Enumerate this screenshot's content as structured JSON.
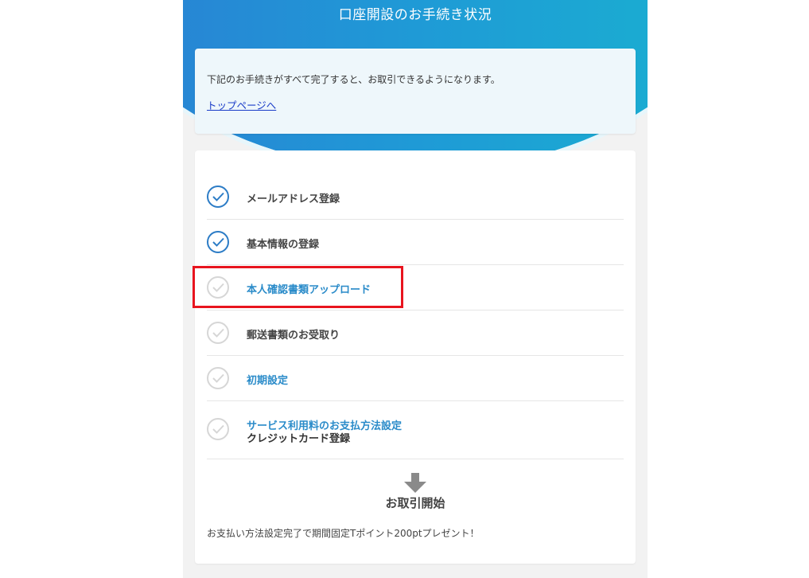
{
  "header": {
    "title": "口座開設のお手続き状況"
  },
  "info": {
    "message": "下記のお手続きがすべて完了すると、お取引できるようになります。",
    "top_link": "トップページへ"
  },
  "steps": [
    {
      "label": "メールアドレス登録",
      "status": "done"
    },
    {
      "label": "基本情報の登録",
      "status": "done"
    },
    {
      "label": "本人確認書類アップロード",
      "status": "pending"
    },
    {
      "label": "郵送書類のお受取り",
      "status": "pending"
    },
    {
      "label": "初期設定",
      "status": "pending"
    },
    {
      "label": "サービス利用料のお支払方法設定",
      "sublabel": "クレジットカード登録",
      "status": "pending"
    }
  ],
  "footer": {
    "start_label": "お取引開始",
    "promo": "お支払い方法設定完了で期間固定Tポイント200ptプレゼント！"
  },
  "colors": {
    "accent": "#2a8bc9",
    "done_check": "#2c7cc6",
    "pending_check": "#d6d6d6",
    "highlight": "#e8141e",
    "link": "#1a3cc8"
  },
  "icons": {
    "check": "check-circle-icon",
    "arrow": "arrow-down-icon"
  }
}
